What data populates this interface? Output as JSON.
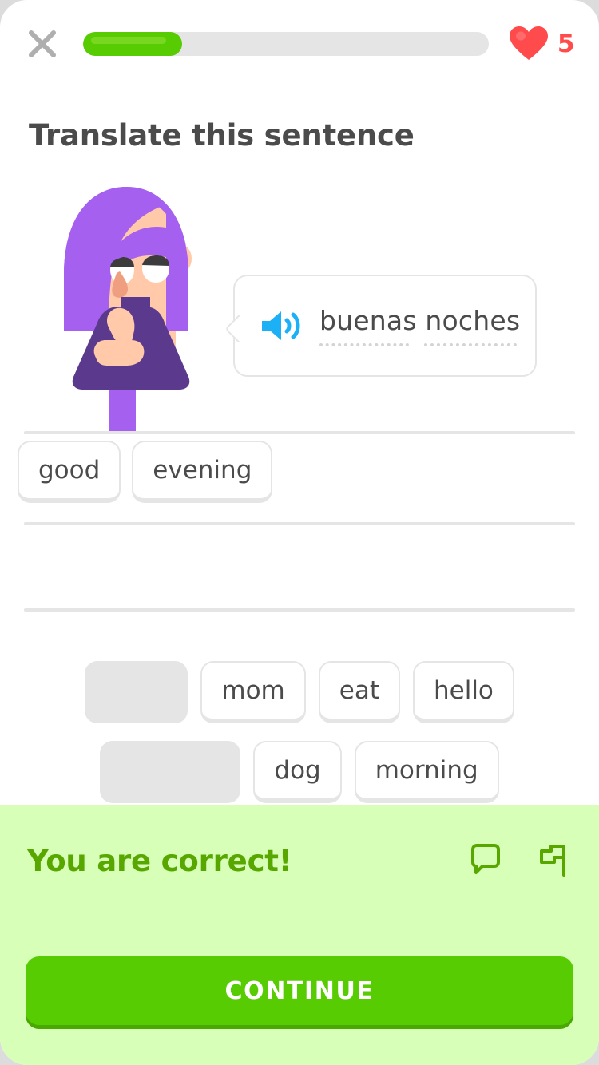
{
  "header": {
    "close_icon": "close-icon",
    "progress_percent": 24.5,
    "heart_icon": "heart-icon",
    "heart_count": "5"
  },
  "exercise": {
    "title": "Translate this sentence",
    "character": "lily-character",
    "bubble": {
      "speaker_icon": "speaker-icon",
      "prompt_text": "buenas noches"
    }
  },
  "answer": {
    "tiles": [
      "good",
      "evening"
    ]
  },
  "word_bank": {
    "row1": [
      {
        "label": "good",
        "used": true
      },
      {
        "label": "mom",
        "used": false
      },
      {
        "label": "eat",
        "used": false
      },
      {
        "label": "hello",
        "used": false
      }
    ],
    "row2": [
      {
        "label": "evening",
        "used": true
      },
      {
        "label": "dog",
        "used": false
      },
      {
        "label": "morning",
        "used": false
      }
    ]
  },
  "footer": {
    "result_text": "You are correct!",
    "report_icon": "chat-bubble-icon",
    "flag_icon": "flag-icon",
    "continue_label": "CONTINUE"
  },
  "colors": {
    "brand_green": "#58cc02",
    "dark_green": "#58a700",
    "footer_green": "#d7ffb8",
    "heart_red": "#ff4b4b",
    "speaker_blue": "#1cb0f6",
    "text_gray": "#4b4b4b",
    "border_gray": "#e5e5e5",
    "hair_purple": "#a560f0"
  }
}
